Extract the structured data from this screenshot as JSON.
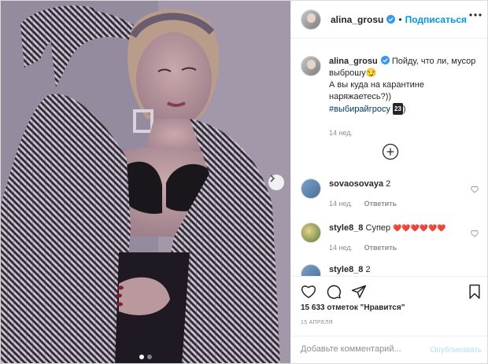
{
  "post": {
    "author": "alina_grosu",
    "follow_label": "Подписаться",
    "separator": "•",
    "caption_line1": "Пойду, что ли, мусор выброшу",
    "caption_emoji": "😏",
    "caption_line2": "А вы куда на карантине наряжаетесь?))",
    "hashtag": "#выбирайгросу",
    "badge": "23",
    "caption_end": ")",
    "caption_time": "14 нед."
  },
  "comments": [
    {
      "user": "sovaosovaya",
      "text": "2",
      "time": "14 нед.",
      "reply": "Ответить"
    },
    {
      "user": "style8_8",
      "text": "Супер",
      "emoji": "❤️❤️❤️❤️❤️❤️",
      "time": "14 нед.",
      "reply": "Ответить"
    },
    {
      "user": "style8_8",
      "text": "2"
    }
  ],
  "footer": {
    "likes": "15 633 отметок \"Нравится\"",
    "date": "15 АПРЕЛЯ",
    "comment_placeholder": "Добавьте комментарий...",
    "publish_label": "Опубликовать"
  },
  "icons": [
    "more-icon",
    "verified-icon",
    "next-arrow-icon",
    "load-more-icon",
    "heart-icon",
    "comment-icon",
    "share-icon",
    "bookmark-icon"
  ],
  "colors": {
    "accent": "#0095f6",
    "text": "#262626",
    "muted": "#8e8e8e",
    "heart_red": "#d42030"
  }
}
